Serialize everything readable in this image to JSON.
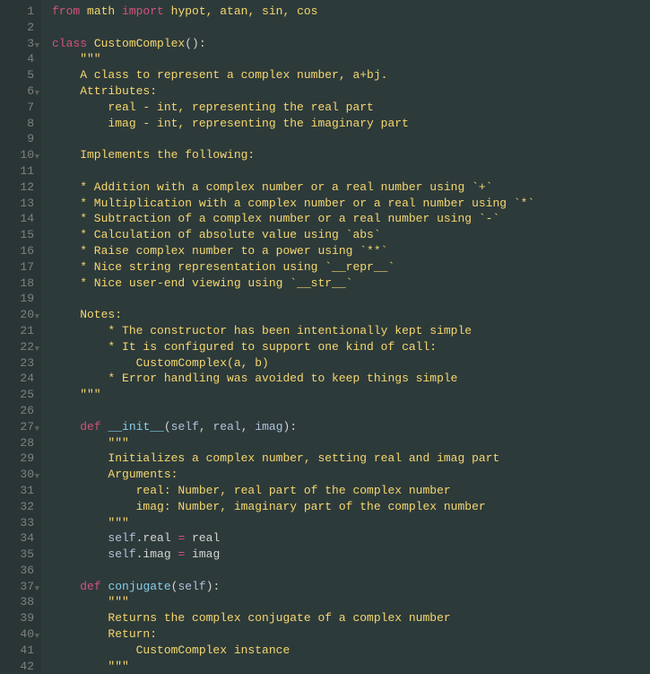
{
  "lines": [
    {
      "n": 1,
      "fold": false,
      "tokens": [
        {
          "t": "from ",
          "c": "kw"
        },
        {
          "t": "math ",
          "c": "cls"
        },
        {
          "t": "import ",
          "c": "kw"
        },
        {
          "t": "hypot, atan, sin, cos",
          "c": "cls"
        }
      ]
    },
    {
      "n": 2,
      "fold": false,
      "tokens": []
    },
    {
      "n": 3,
      "fold": true,
      "tokens": [
        {
          "t": "class ",
          "c": "kw"
        },
        {
          "t": "CustomComplex",
          "c": "cls"
        },
        {
          "t": "():",
          "c": "pun"
        }
      ]
    },
    {
      "n": 4,
      "fold": false,
      "tokens": [
        {
          "t": "    \"\"\"",
          "c": "str"
        }
      ]
    },
    {
      "n": 5,
      "fold": false,
      "tokens": [
        {
          "t": "    A class to represent a complex number, a+bj.",
          "c": "str"
        }
      ]
    },
    {
      "n": 6,
      "fold": true,
      "tokens": [
        {
          "t": "    Attributes:",
          "c": "str"
        }
      ]
    },
    {
      "n": 7,
      "fold": false,
      "tokens": [
        {
          "t": "        real - int, representing the real part",
          "c": "str"
        }
      ]
    },
    {
      "n": 8,
      "fold": false,
      "tokens": [
        {
          "t": "        imag - int, representing the imaginary part",
          "c": "str"
        }
      ]
    },
    {
      "n": 9,
      "fold": false,
      "tokens": []
    },
    {
      "n": 10,
      "fold": true,
      "tokens": [
        {
          "t": "    Implements the following:",
          "c": "str"
        }
      ]
    },
    {
      "n": 11,
      "fold": false,
      "tokens": []
    },
    {
      "n": 12,
      "fold": false,
      "tokens": [
        {
          "t": "    * Addition with a complex number or a real number using `+`",
          "c": "str"
        }
      ]
    },
    {
      "n": 13,
      "fold": false,
      "tokens": [
        {
          "t": "    * Multiplication with a complex number or a real number using `*`",
          "c": "str"
        }
      ]
    },
    {
      "n": 14,
      "fold": false,
      "tokens": [
        {
          "t": "    * Subtraction of a complex number or a real number using `-`",
          "c": "str"
        }
      ]
    },
    {
      "n": 15,
      "fold": false,
      "tokens": [
        {
          "t": "    * Calculation of absolute value using `abs`",
          "c": "str"
        }
      ]
    },
    {
      "n": 16,
      "fold": false,
      "tokens": [
        {
          "t": "    * Raise complex number to a power using `**`",
          "c": "str"
        }
      ]
    },
    {
      "n": 17,
      "fold": false,
      "tokens": [
        {
          "t": "    * Nice string representation using `__repr__`",
          "c": "str"
        }
      ]
    },
    {
      "n": 18,
      "fold": false,
      "tokens": [
        {
          "t": "    * Nice user-end viewing using `__str__`",
          "c": "str"
        }
      ]
    },
    {
      "n": 19,
      "fold": false,
      "tokens": []
    },
    {
      "n": 20,
      "fold": true,
      "tokens": [
        {
          "t": "    Notes:",
          "c": "str"
        }
      ]
    },
    {
      "n": 21,
      "fold": false,
      "tokens": [
        {
          "t": "        * The constructor has been intentionally kept simple",
          "c": "str"
        }
      ]
    },
    {
      "n": 22,
      "fold": true,
      "tokens": [
        {
          "t": "        * It is configured to support one kind of call:",
          "c": "str"
        }
      ]
    },
    {
      "n": 23,
      "fold": false,
      "tokens": [
        {
          "t": "            CustomComplex(a, b)",
          "c": "str"
        }
      ]
    },
    {
      "n": 24,
      "fold": false,
      "tokens": [
        {
          "t": "        * Error handling was avoided to keep things simple",
          "c": "str"
        }
      ]
    },
    {
      "n": 25,
      "fold": false,
      "tokens": [
        {
          "t": "    \"\"\"",
          "c": "str"
        }
      ]
    },
    {
      "n": 26,
      "fold": false,
      "tokens": []
    },
    {
      "n": 27,
      "fold": true,
      "tokens": [
        {
          "t": "    ",
          "c": ""
        },
        {
          "t": "def ",
          "c": "kw"
        },
        {
          "t": "__init__",
          "c": "fn"
        },
        {
          "t": "(",
          "c": "pun"
        },
        {
          "t": "self",
          "c": "prm"
        },
        {
          "t": ", ",
          "c": "pun"
        },
        {
          "t": "real",
          "c": "prm"
        },
        {
          "t": ", ",
          "c": "pun"
        },
        {
          "t": "imag",
          "c": "prm"
        },
        {
          "t": "):",
          "c": "pun"
        }
      ]
    },
    {
      "n": 28,
      "fold": false,
      "tokens": [
        {
          "t": "        \"\"\"",
          "c": "str"
        }
      ]
    },
    {
      "n": 29,
      "fold": false,
      "tokens": [
        {
          "t": "        Initializes a complex number, setting real and imag part",
          "c": "str"
        }
      ]
    },
    {
      "n": 30,
      "fold": true,
      "tokens": [
        {
          "t": "        Arguments:",
          "c": "str"
        }
      ]
    },
    {
      "n": 31,
      "fold": false,
      "tokens": [
        {
          "t": "            real: Number, real part of the complex number",
          "c": "str"
        }
      ]
    },
    {
      "n": 32,
      "fold": false,
      "tokens": [
        {
          "t": "            imag: Number, imaginary part of the complex number",
          "c": "str"
        }
      ]
    },
    {
      "n": 33,
      "fold": false,
      "tokens": [
        {
          "t": "        \"\"\"",
          "c": "str"
        }
      ]
    },
    {
      "n": 34,
      "fold": false,
      "tokens": [
        {
          "t": "        self",
          "c": "prm"
        },
        {
          "t": ".real ",
          "c": "pun"
        },
        {
          "t": "= ",
          "c": "op"
        },
        {
          "t": "real",
          "c": "pun"
        }
      ]
    },
    {
      "n": 35,
      "fold": false,
      "tokens": [
        {
          "t": "        self",
          "c": "prm"
        },
        {
          "t": ".imag ",
          "c": "pun"
        },
        {
          "t": "= ",
          "c": "op"
        },
        {
          "t": "imag",
          "c": "pun"
        }
      ]
    },
    {
      "n": 36,
      "fold": false,
      "tokens": []
    },
    {
      "n": 37,
      "fold": true,
      "tokens": [
        {
          "t": "    ",
          "c": ""
        },
        {
          "t": "def ",
          "c": "kw"
        },
        {
          "t": "conjugate",
          "c": "fn"
        },
        {
          "t": "(",
          "c": "pun"
        },
        {
          "t": "self",
          "c": "prm"
        },
        {
          "t": "):",
          "c": "pun"
        }
      ]
    },
    {
      "n": 38,
      "fold": false,
      "tokens": [
        {
          "t": "        \"\"\"",
          "c": "str"
        }
      ]
    },
    {
      "n": 39,
      "fold": false,
      "tokens": [
        {
          "t": "        Returns the complex conjugate of a complex number",
          "c": "str"
        }
      ]
    },
    {
      "n": 40,
      "fold": true,
      "tokens": [
        {
          "t": "        Return:",
          "c": "str"
        }
      ]
    },
    {
      "n": 41,
      "fold": false,
      "tokens": [
        {
          "t": "            CustomComplex instance",
          "c": "str"
        }
      ]
    },
    {
      "n": 42,
      "fold": false,
      "tokens": [
        {
          "t": "        \"\"\"",
          "c": "str"
        }
      ]
    }
  ]
}
